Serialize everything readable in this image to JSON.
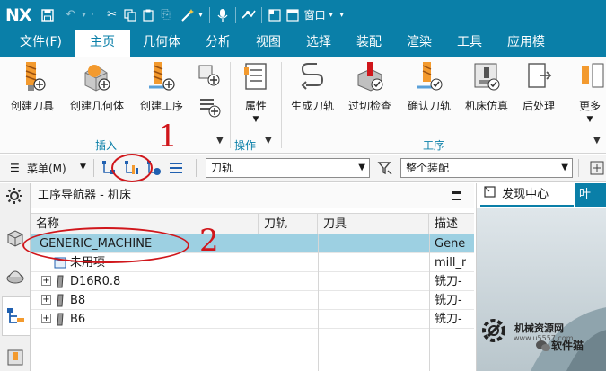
{
  "app": {
    "logo": "NX",
    "window_menu": "窗口",
    "title_icons": [
      "save-icon",
      "undo-icon",
      "more-dropdown",
      "cut-icon",
      "copy-icon",
      "paste-icon",
      "paste-special-icon",
      "wand-icon",
      "microphone-icon",
      "command-finder-icon",
      "window-icon"
    ]
  },
  "menubar": {
    "items": [
      "文件(F)",
      "主页",
      "几何体",
      "分析",
      "视图",
      "选择",
      "装配",
      "渲染",
      "工具",
      "应用模"
    ],
    "active": "主页"
  },
  "ribbon": {
    "insert_group": {
      "label": "插入",
      "buttons": [
        "创建刀具",
        "创建几何体",
        "创建工序"
      ]
    },
    "operations_group": {
      "label": "操作",
      "buttons": [
        "属性"
      ]
    },
    "process_group": {
      "label": "工序",
      "buttons": [
        "生成刀轨",
        "过切检查",
        "确认刀轨",
        "机床仿真",
        "后处理",
        "更多"
      ]
    }
  },
  "toolbar2": {
    "menu_label": "菜单(M)",
    "filter_value": "刀轨",
    "assembly_value": "整个装配"
  },
  "navigator": {
    "title": "工序导航器 - 机床",
    "columns": [
      "名称",
      "刀轨",
      "刀具",
      "描述"
    ],
    "rows": [
      {
        "name": "GENERIC_MACHINE",
        "description": "Gene",
        "selected": true
      },
      {
        "name": "未用项",
        "description": "mill_r",
        "selected": false
      },
      {
        "name": "D16R0.8",
        "description": "铣刀-",
        "selected": false
      },
      {
        "name": "B8",
        "description": "铣刀-",
        "selected": false
      },
      {
        "name": "B6",
        "description": "铣刀-",
        "selected": false
      }
    ]
  },
  "right_panel": {
    "tab1": "发现中心",
    "tab2": "叶"
  },
  "annotations": {
    "marker1": "1",
    "marker2": "2"
  },
  "watermark": {
    "site": "机械资源网",
    "url": "www.u5557.com",
    "tag": "软件猫"
  },
  "colors": {
    "titlebar": "#0a7fa8",
    "selection": "#9dd0e2",
    "annotation": "#d0161b"
  }
}
